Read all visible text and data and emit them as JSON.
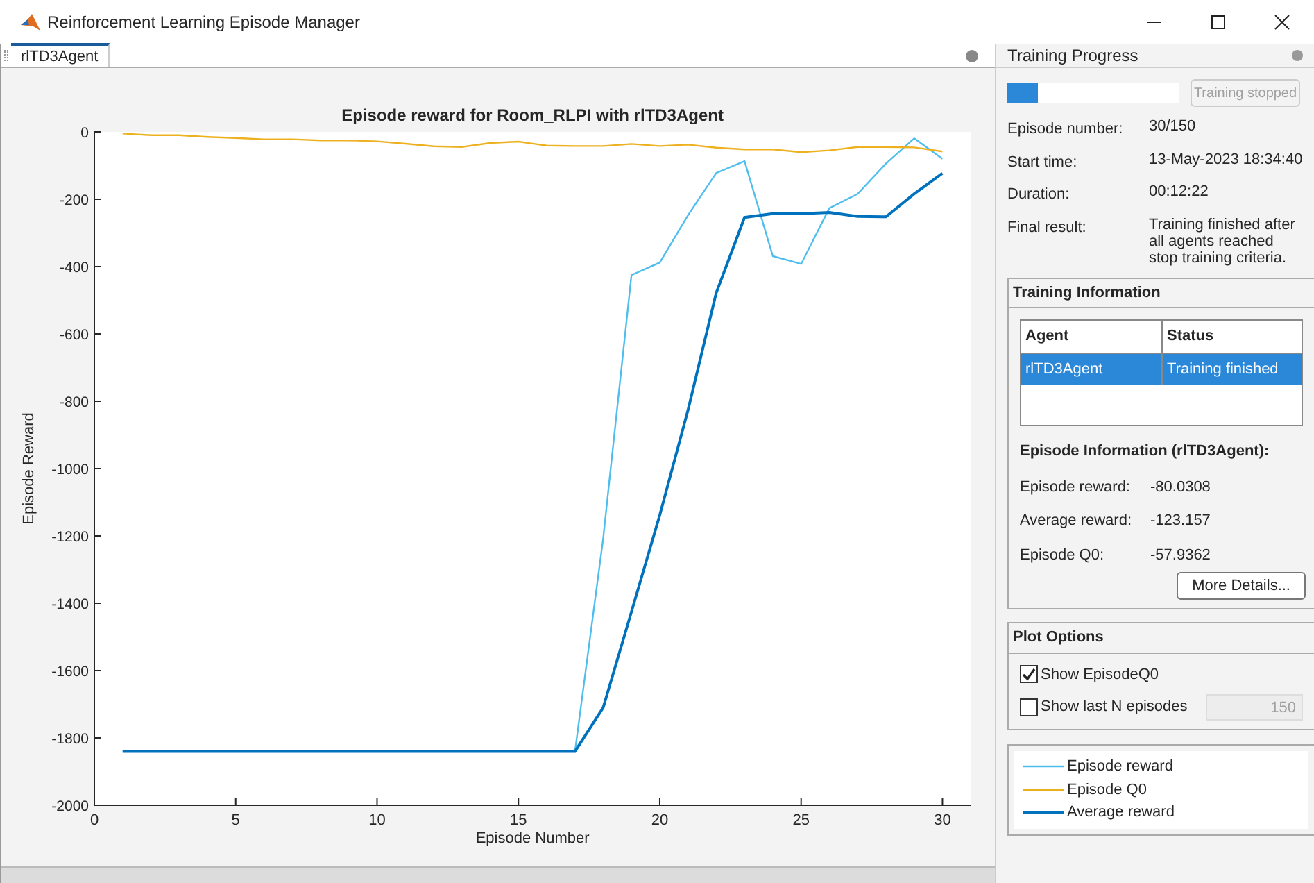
{
  "window": {
    "title": "Reinforcement Learning Episode Manager"
  },
  "document_tabs": [
    {
      "label": "rlTD3Agent",
      "selected": true
    }
  ],
  "plot": {
    "chart_data": {
      "type": "line",
      "title": "Episode reward for Room_RLPI with rlTD3Agent",
      "xlabel": "Episode Number",
      "ylabel": "Episode Reward",
      "x": [
        1,
        2,
        3,
        4,
        5,
        6,
        7,
        8,
        9,
        10,
        11,
        12,
        13,
        14,
        15,
        16,
        17,
        18,
        19,
        20,
        21,
        22,
        23,
        24,
        25,
        26,
        27,
        28,
        29,
        30
      ],
      "xlim": [
        0,
        31
      ],
      "ylim": [
        -2000,
        0
      ],
      "xticks": [
        0,
        5,
        10,
        15,
        20,
        25,
        30
      ],
      "yticks": [
        -2000,
        -1800,
        -1600,
        -1400,
        -1200,
        -1000,
        -800,
        -600,
        -400,
        -200,
        0
      ],
      "series": [
        {
          "name": "Episode reward",
          "color": "#4dbeee",
          "values": [
            -1840,
            -1840,
            -1840,
            -1840,
            -1840,
            -1840,
            -1840,
            -1840,
            -1840,
            -1840,
            -1840,
            -1840,
            -1840,
            -1840,
            -1840,
            -1840,
            -1840,
            -1208,
            -425,
            -388,
            -247,
            -122,
            -87,
            -369,
            -392,
            -227,
            -184,
            -94,
            -19,
            -80
          ]
        },
        {
          "name": "Episode Q0",
          "color": "#edb120",
          "values": [
            -5,
            -10,
            -10,
            -15,
            -18,
            -22,
            -22,
            -25,
            -25,
            -28,
            -35,
            -43,
            -45,
            -33,
            -29,
            -41,
            -42,
            -42,
            -36,
            -42,
            -38,
            -47,
            -52,
            -52,
            -60,
            -55,
            -45,
            -45,
            -46,
            -58
          ]
        },
        {
          "name": "Average reward",
          "color": "#0072bd",
          "values": [
            -1840,
            -1840,
            -1840,
            -1840,
            -1840,
            -1840,
            -1840,
            -1840,
            -1840,
            -1840,
            -1840,
            -1840,
            -1840,
            -1840,
            -1840,
            -1840,
            -1840,
            -1710,
            -1425,
            -1138,
            -825,
            -478,
            -254,
            -243,
            -243,
            -239,
            -251,
            -252,
            -184,
            -123
          ]
        }
      ]
    }
  },
  "training_progress": {
    "title": "Training Progress",
    "level": 0.18,
    "stop_button": {
      "label": "Training stopped",
      "disabled": true
    },
    "fields": [
      {
        "label": "Episode number:",
        "value": "30/150"
      },
      {
        "label": "Start time:",
        "value": "13-May-2023 18:34:40"
      },
      {
        "label": "Duration:",
        "value": "00:12:22"
      },
      {
        "label": "Final result:",
        "value": "Training finished after all agents reached stop training criteria."
      }
    ]
  },
  "training_information": {
    "title": "Training Information",
    "columns": [
      "Agent",
      "Status"
    ],
    "rows": [
      {
        "agent": "rlTD3Agent",
        "status": "Training finished",
        "selected": true
      }
    ],
    "episode_information": {
      "title": "Episode Information (rlTD3Agent):",
      "fields": [
        {
          "label": "Episode reward:",
          "value": "-80.0308"
        },
        {
          "label": "Average reward:",
          "value": "-123.157"
        },
        {
          "label": "Episode Q0:",
          "value": "-57.9362"
        }
      ]
    },
    "more_details_button": "More Details..."
  },
  "plot_options": {
    "title": "Plot Options",
    "options": [
      {
        "kind": "checkbox",
        "label": "Show EpisodeQ0",
        "checked": true
      },
      {
        "kind": "checkbox_with_field",
        "label": "Show last N episodes",
        "checked": false,
        "field": {
          "value": "150",
          "disabled": true
        }
      }
    ]
  }
}
